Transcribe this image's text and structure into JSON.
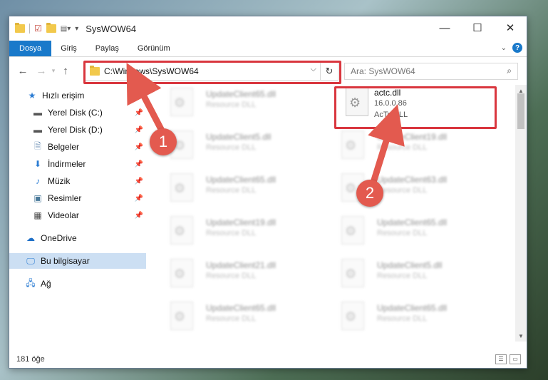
{
  "window": {
    "title": "SysWOW64",
    "minimize": "—",
    "maximize": "☐",
    "close": "✕"
  },
  "ribbon": {
    "file": "Dosya",
    "tabs": [
      "Giriş",
      "Paylaş",
      "Görünüm"
    ],
    "help": "?"
  },
  "nav": {
    "back": "←",
    "forward": "→",
    "up": "↑",
    "address": "C:\\Windows\\SysWOW64",
    "search_placeholder": "Ara: SysWOW64"
  },
  "sidebar": {
    "quick_access": "Hızlı erişim",
    "items": [
      {
        "label": "Yerel Disk (C:)"
      },
      {
        "label": "Yerel Disk (D:)"
      },
      {
        "label": "Belgeler"
      },
      {
        "label": "İndirmeler"
      },
      {
        "label": "Müzik"
      },
      {
        "label": "Resimler"
      },
      {
        "label": "Videolar"
      }
    ],
    "onedrive": "OneDrive",
    "this_pc": "Bu bilgisayar",
    "network": "Ağ"
  },
  "files": {
    "selected": {
      "name": "actc.dll",
      "version": "16.0.0.86",
      "type": "AcTc DLL"
    },
    "left_column": [
      {
        "name": "UpdateClient65.dll",
        "type": "Resource DLL"
      },
      {
        "name": "UpdateClient5.dll",
        "type": "Resource DLL"
      },
      {
        "name": "UpdateClient65.dll",
        "type": "Resource DLL"
      },
      {
        "name": "UpdateClient19.dll",
        "type": "Resource DLL"
      },
      {
        "name": "UpdateClient21.dll",
        "type": "Resource DLL"
      },
      {
        "name": "UpdateClient65.dll",
        "type": "Resource DLL"
      }
    ],
    "right_column": [
      {
        "name": "UpdateClient19.dll",
        "type": "Resource DLL"
      },
      {
        "name": "UpdateClient63.dll",
        "type": "Resource DLL"
      },
      {
        "name": "UpdateClient65.dll",
        "type": "Resource DLL"
      },
      {
        "name": "UpdateClient5.dll",
        "type": "Resource DLL"
      },
      {
        "name": "UpdateClient65.dll",
        "type": "Resource DLL"
      }
    ]
  },
  "status": {
    "count": "181 öğe"
  },
  "annotations": {
    "step1": "1",
    "step2": "2"
  },
  "colors": {
    "accent": "#1979ca",
    "highlight": "#d9363e",
    "badge": "#e35a4f"
  }
}
